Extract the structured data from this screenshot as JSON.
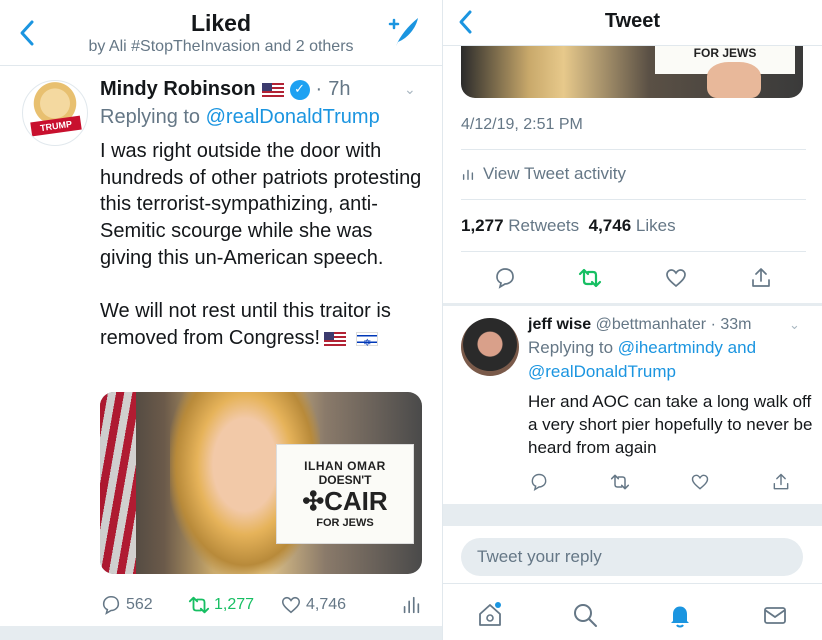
{
  "left": {
    "header": {
      "title": "Liked",
      "subtitle": "by Ali #StopTheInvasion and 2 others"
    },
    "tweet": {
      "avatar_text": "TRUMP",
      "author_name": "Mindy Robinson",
      "time": "7h",
      "replying_prefix": "Replying to",
      "replying_to": "@realDonaldTrump",
      "body": "I was right outside the door with hundreds of other patriots protesting this terrorist-sympathizing, anti-Semitic scourge while she was giving this un-American speech.\n\nWe will not rest until this traitor is removed from Congress!",
      "image_sign": {
        "line1": "ILHAN OMAR",
        "line2": "DOESN'T",
        "line3": "CAIR",
        "line4": "FOR JEWS"
      },
      "actions": {
        "replies": "562",
        "retweets": "1,277",
        "likes": "4,746"
      }
    }
  },
  "right": {
    "header": {
      "title": "Tweet"
    },
    "image_sign_partial": "FOR JEWS",
    "timestamp": "4/12/19, 2:51 PM",
    "activity_label": "View Tweet activity",
    "counts": {
      "retweets": "1,277",
      "retweets_label": "Retweets",
      "likes": "4,746",
      "likes_label": "Likes"
    },
    "reply": {
      "name": "jeff wise",
      "handle": "@bettmanhater",
      "time": "33m",
      "replying_prefix": "Replying to",
      "replying_to_1": "@iheartmindy",
      "replying_and": "and",
      "replying_to_2": "@realDonaldTrump",
      "body": "Her and AOC can take a long walk off a very short pier hopefully to never be heard from again"
    },
    "reply_input_placeholder": "Tweet your reply"
  },
  "colors": {
    "accent": "#1b95e0",
    "retweet_green": "#17bf63",
    "text_grey": "#657786",
    "divider": "#e1e8ed"
  },
  "icons": [
    "back-chevron-icon",
    "compose-icon",
    "verified-icon",
    "reply-icon",
    "retweet-icon",
    "like-icon",
    "share-icon",
    "analytics-icon",
    "home-icon",
    "search-icon",
    "notifications-icon",
    "messages-icon"
  ]
}
